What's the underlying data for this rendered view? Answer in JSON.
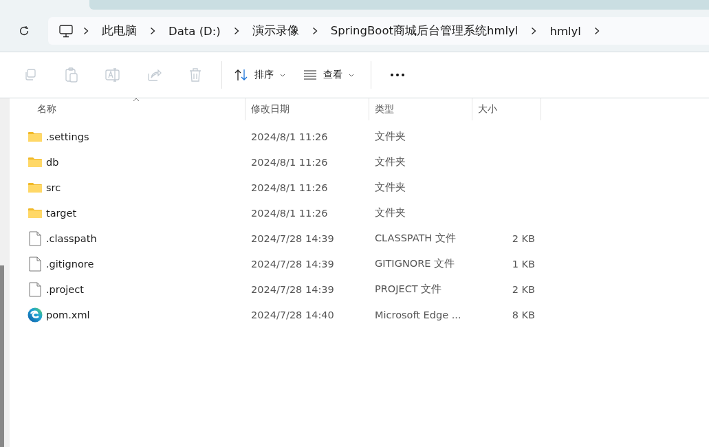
{
  "breadcrumb": [
    {
      "label": "此电脑"
    },
    {
      "label": "Data (D:)"
    },
    {
      "label": "演示录像"
    },
    {
      "label": "SpringBoot商城后台管理系统hmlyl"
    },
    {
      "label": "hmlyl"
    }
  ],
  "toolbar": {
    "actions": [
      {
        "kind": "copy",
        "disabled": true
      },
      {
        "kind": "paste",
        "disabled": true
      },
      {
        "kind": "rename",
        "disabled": true
      },
      {
        "kind": "share",
        "disabled": true
      },
      {
        "kind": "delete",
        "disabled": true
      }
    ],
    "sort": {
      "label": "排序"
    },
    "view": {
      "label": "查看"
    }
  },
  "table": {
    "columns": [
      {
        "label": "名称",
        "sorted": true
      },
      {
        "label": "修改日期",
        "sorted": false
      },
      {
        "label": "类型",
        "sorted": false
      },
      {
        "label": "大小",
        "sorted": false
      }
    ],
    "rows": [
      {
        "kind": "folder",
        "name": ".settings",
        "date": "2024/8/1 11:26",
        "type": "文件夹",
        "size": ""
      },
      {
        "kind": "folder",
        "name": "db",
        "date": "2024/8/1 11:26",
        "type": "文件夹",
        "size": ""
      },
      {
        "kind": "folder",
        "name": "src",
        "date": "2024/8/1 11:26",
        "type": "文件夹",
        "size": ""
      },
      {
        "kind": "folder",
        "name": "target",
        "date": "2024/8/1 11:26",
        "type": "文件夹",
        "size": ""
      },
      {
        "kind": "file",
        "name": ".classpath",
        "date": "2024/7/28 14:39",
        "type": "CLASSPATH 文件",
        "size": "2 KB"
      },
      {
        "kind": "file",
        "name": ".gitignore",
        "date": "2024/7/28 14:39",
        "type": "GITIGNORE 文件",
        "size": "1 KB"
      },
      {
        "kind": "file",
        "name": ".project",
        "date": "2024/7/28 14:39",
        "type": "PROJECT 文件",
        "size": "2 KB"
      },
      {
        "kind": "browser",
        "name": "pom.xml",
        "date": "2024/7/28 14:40",
        "type": "Microsoft Edge ...",
        "size": "8 KB"
      }
    ]
  }
}
